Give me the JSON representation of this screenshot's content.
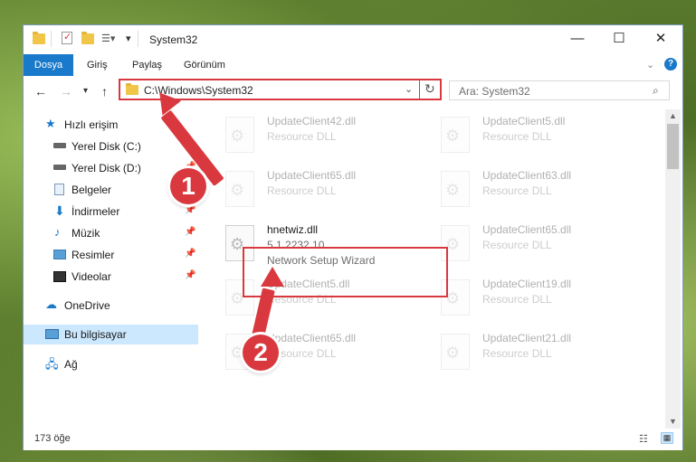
{
  "window": {
    "title": "System32"
  },
  "ribbon": {
    "file_tab": "Dosya",
    "tabs": [
      "Giriş",
      "Paylaş",
      "Görünüm"
    ]
  },
  "address": {
    "path": "C:\\Windows\\System32"
  },
  "search": {
    "placeholder": "Ara: System32"
  },
  "sidebar": {
    "quick_access": "Hızlı erişim",
    "items": [
      {
        "label": "Yerel Disk (C:)",
        "icon": "drive-icon",
        "pinned": true
      },
      {
        "label": "Yerel Disk (D:)",
        "icon": "drive-icon",
        "pinned": true
      },
      {
        "label": "Belgeler",
        "icon": "documents-icon",
        "pinned": true
      },
      {
        "label": "İndirmeler",
        "icon": "download-icon",
        "pinned": true
      },
      {
        "label": "Müzik",
        "icon": "music-icon",
        "pinned": true
      },
      {
        "label": "Resimler",
        "icon": "pictures-icon",
        "pinned": true
      },
      {
        "label": "Videolar",
        "icon": "videos-icon",
        "pinned": true
      }
    ],
    "onedrive": "OneDrive",
    "this_pc": "Bu bilgisayar",
    "network": "Ağ"
  },
  "files": [
    {
      "name": "UpdateClient42.dll",
      "desc": "Resource DLL"
    },
    {
      "name": "UpdateClient5.dll",
      "desc": "Resource DLL"
    },
    {
      "name": "UpdateClient65.dll",
      "desc": "Resource DLL"
    },
    {
      "name": "UpdateClient63.dll",
      "desc": "Resource DLL"
    },
    {
      "name": "hnetwiz.dll",
      "version": "5.1.2232.10",
      "desc": "Network Setup Wizard"
    },
    {
      "name": "UpdateClient65.dll",
      "desc": "Resource DLL"
    },
    {
      "name": "UpdateClient5.dll",
      "desc": "Resource DLL"
    },
    {
      "name": "UpdateClient19.dll",
      "desc": "Resource DLL"
    },
    {
      "name": "UpdateClient65.dll",
      "desc": "Resource DLL"
    },
    {
      "name": "UpdateClient21.dll",
      "desc": "Resource DLL"
    }
  ],
  "status": {
    "count": "173 öğe"
  },
  "annotations": {
    "step1": "1",
    "step2": "2"
  },
  "colors": {
    "accent": "#1979ca",
    "highlight": "#d9393e"
  }
}
